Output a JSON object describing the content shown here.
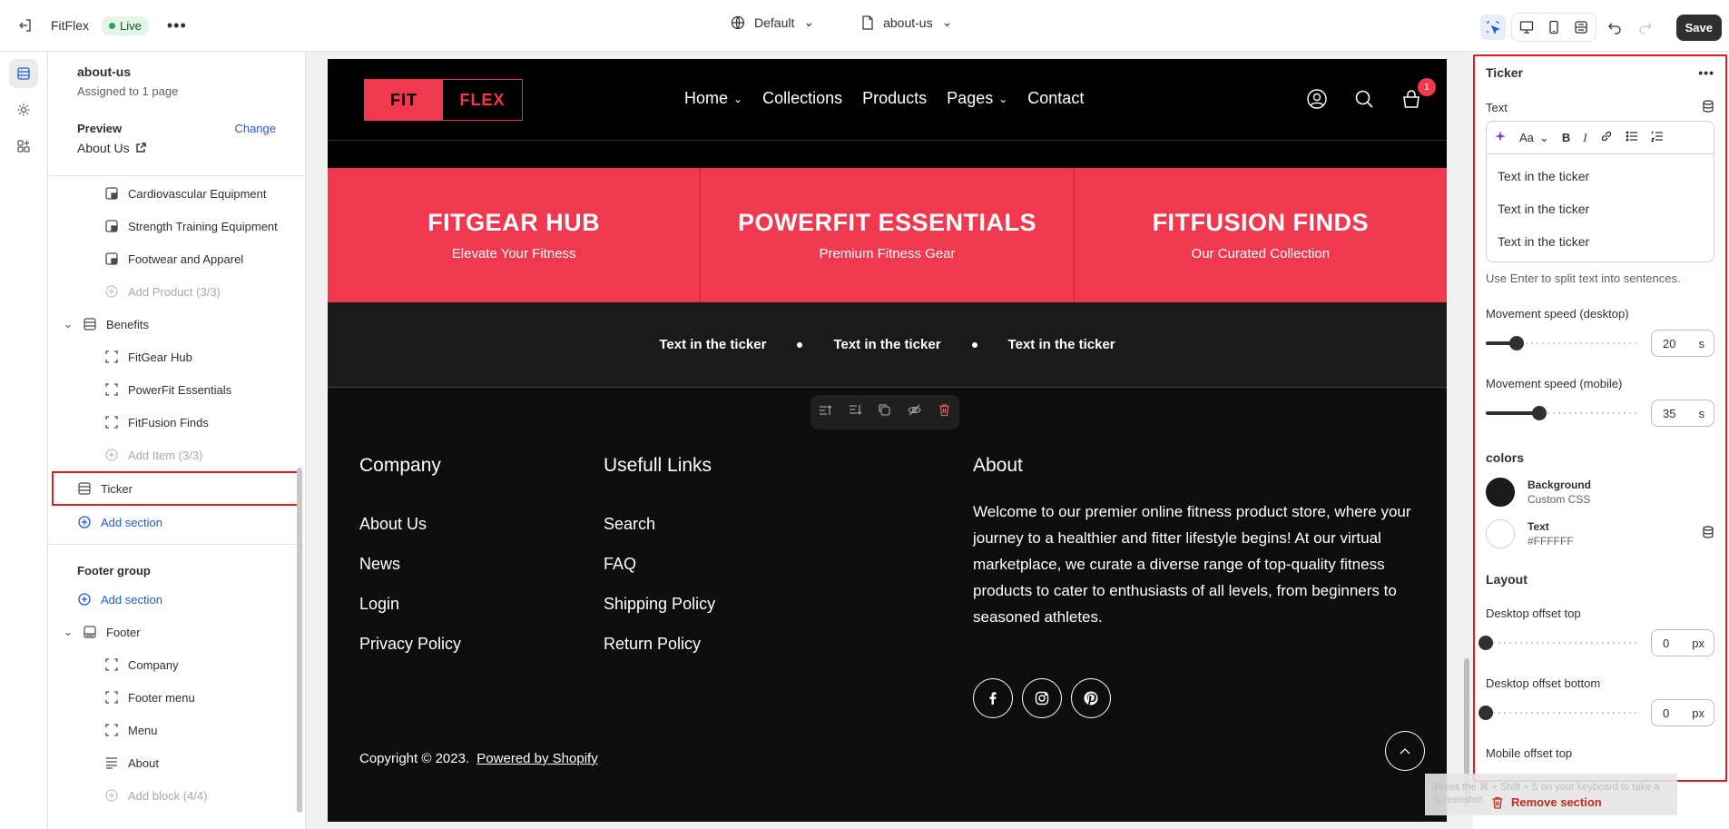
{
  "topbar": {
    "app_name": "FitFlex",
    "status": "Live",
    "theme": "Default",
    "template": "about-us",
    "save_label": "Save"
  },
  "sidebar": {
    "template_title": "about-us",
    "assigned": "Assigned to 1 page",
    "preview_label": "Preview",
    "change_label": "Change",
    "preview_page": "About Us",
    "items": [
      {
        "label": "Cardiovascular Equipment"
      },
      {
        "label": "Strength Training Equipment"
      },
      {
        "label": "Footwear and Apparel"
      },
      {
        "label": "Add Product (3/3)"
      },
      {
        "label": "Benefits"
      },
      {
        "label": "FitGear Hub"
      },
      {
        "label": "PowerFit Essentials"
      },
      {
        "label": "FitFusion Finds"
      },
      {
        "label": "Add Item (3/3)"
      },
      {
        "label": "Ticker"
      },
      {
        "label": "Add section"
      }
    ],
    "footer_group": {
      "title": "Footer group",
      "add_section": "Add section",
      "footer": "Footer",
      "blocks": [
        "Company",
        "Footer menu",
        "Menu",
        "About",
        "Add block (4/4)"
      ]
    }
  },
  "store": {
    "logo_a": "FIT",
    "logo_b": "FLEX",
    "nav": [
      "Home",
      "Collections",
      "Products",
      "Pages",
      "Contact"
    ],
    "cart_count": "1",
    "benefits": [
      {
        "title": "FITGEAR HUB",
        "sub": "Elevate Your Fitness"
      },
      {
        "title": "POWERFIT ESSENTIALS",
        "sub": "Premium Fitness Gear"
      },
      {
        "title": "FITFUSION FINDS",
        "sub": "Our Curated Collection"
      }
    ],
    "ticker": [
      "Text in the ticker",
      "Text in the ticker",
      "Text in the ticker"
    ],
    "footer": {
      "company_title": "Company",
      "company_links": [
        "About Us",
        "News",
        "Login",
        "Privacy Policy"
      ],
      "links_title": "Usefull Links",
      "links": [
        "Search",
        "FAQ",
        "Shipping Policy",
        "Return Policy"
      ],
      "about_title": "About",
      "about_text": "Welcome to our premier online fitness product store, where your journey to a healthier and fitter lifestyle begins! At our virtual marketplace, we curate a diverse range of top-quality fitness products to cater to enthusiasts of all levels, from beginners to seasoned athletes.",
      "copyright": "Copyright © 2023.",
      "powered": "Powered by Shopify"
    }
  },
  "panel": {
    "title": "Ticker",
    "text_label": "Text",
    "font_btn": "Aa",
    "lines": [
      "Text in the ticker",
      "Text in the ticker",
      "Text in the ticker"
    ],
    "hint": "Use Enter to split text into sentences.",
    "speed_desktop_label": "Movement speed (desktop)",
    "speed_desktop": "20",
    "speed_desktop_fraction": 0.2,
    "speed_mobile_label": "Movement speed (mobile)",
    "speed_mobile": "35",
    "speed_mobile_fraction": 0.35,
    "unit_s": "s",
    "colors_title": "colors",
    "bg_label": "Background",
    "bg_value": "Custom CSS",
    "text_color_label": "Text",
    "text_color_value": "#FFFFFF",
    "layout_title": "Layout",
    "desk_top_label": "Desktop offset top",
    "desk_top": "0",
    "desk_bottom_label": "Desktop offset bottom",
    "desk_bottom": "0",
    "mobile_top_label": "Mobile offset top",
    "unit_px": "px",
    "remove_label": "Remove section",
    "toast_text": "Press the ⌘ + Shift + S on your keyboard to take a screenshot"
  },
  "colors": {
    "accent": "#f0384e",
    "primary": "#1f5bd8",
    "danger": "#c5281c"
  }
}
